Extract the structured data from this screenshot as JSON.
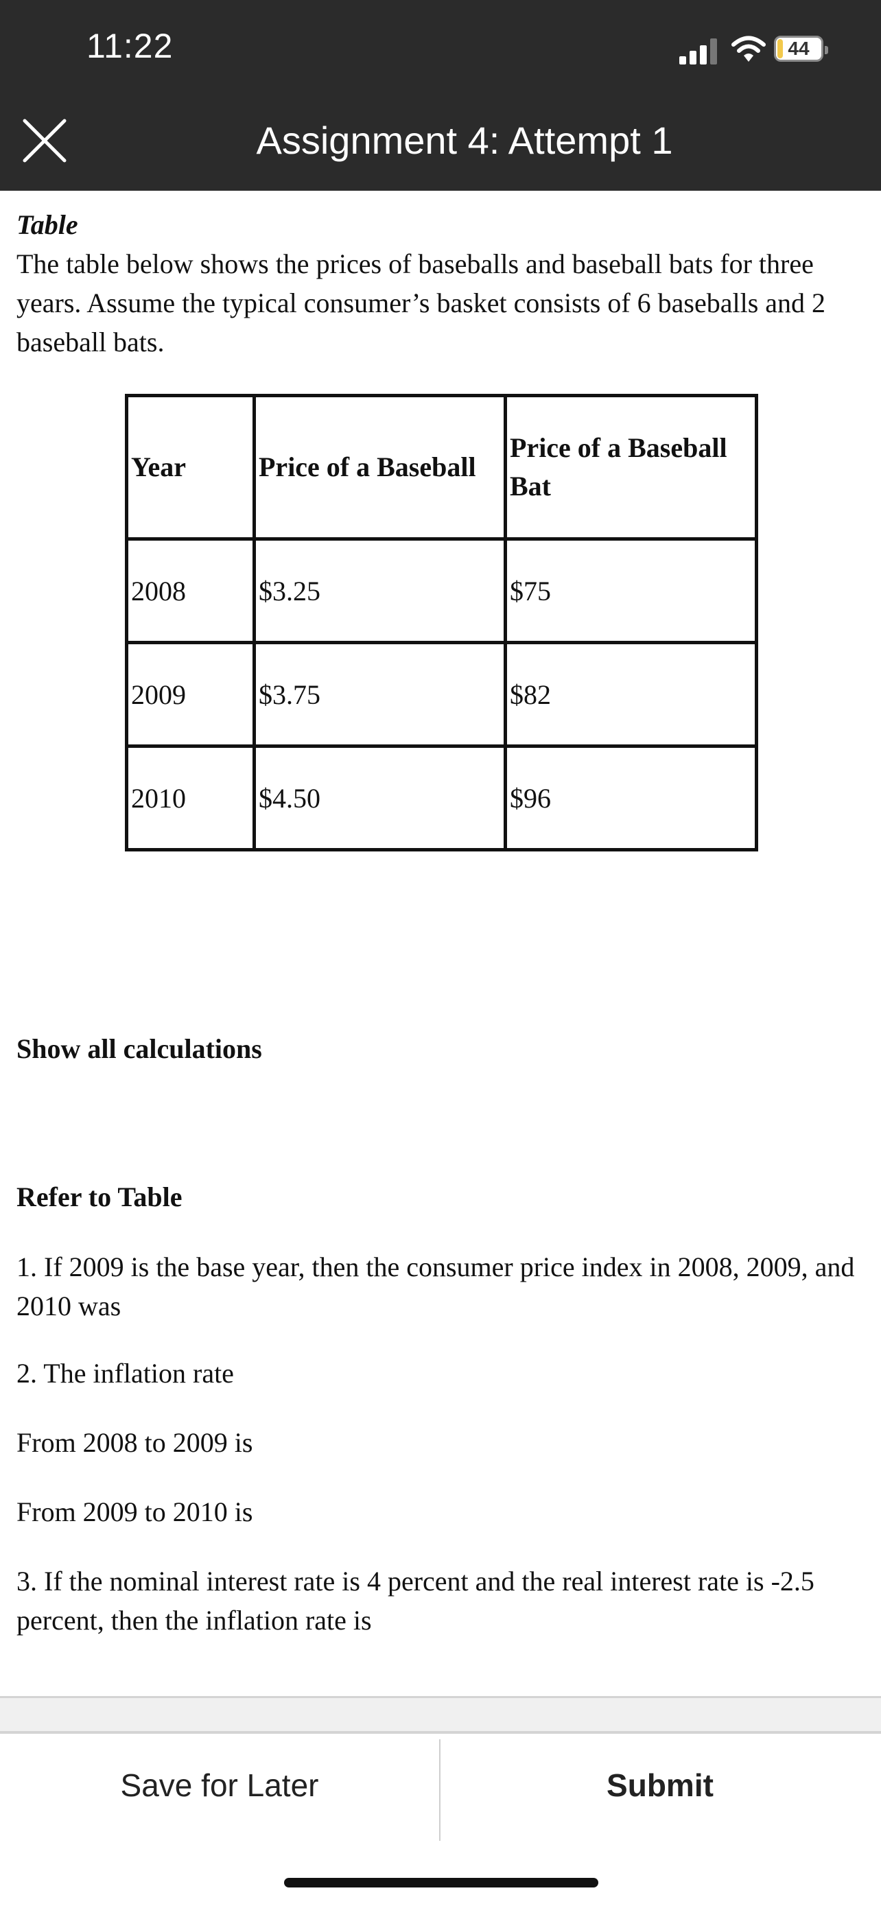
{
  "status_bar": {
    "time": "11:22",
    "battery": "44"
  },
  "header": {
    "title": "Assignment 4: Attempt 1"
  },
  "content": {
    "table_caption": "Table",
    "intro": "The table below shows the prices of baseballs and baseball bats for three years. Assume the typical consumer’s basket consists of 6 baseballs and 2 baseball bats.",
    "table": {
      "headers": [
        "Year",
        "Price of a Baseball",
        "Price of a Baseball Bat"
      ],
      "rows": [
        [
          "2008",
          "$3.25",
          "$75"
        ],
        [
          "2009",
          "$3.75",
          "$82"
        ],
        [
          "2010",
          "$4.50",
          "$96"
        ]
      ]
    },
    "show_all": "Show all calculations",
    "refer": "Refer to Table",
    "q1": "1. If 2009 is the base year, then the consumer price index in 2008, 2009, and 2010 was",
    "q2": "2. The inflation rate",
    "q2a": "From 2008 to 2009 is",
    "q2b": "From 2009 to 2010 is",
    "q3": "3. If the nominal interest rate is 4 percent and the real interest rate is -2.5 percent, then the inflation rate is"
  },
  "footer": {
    "save_label": "Save for Later",
    "submit_label": "Submit"
  }
}
